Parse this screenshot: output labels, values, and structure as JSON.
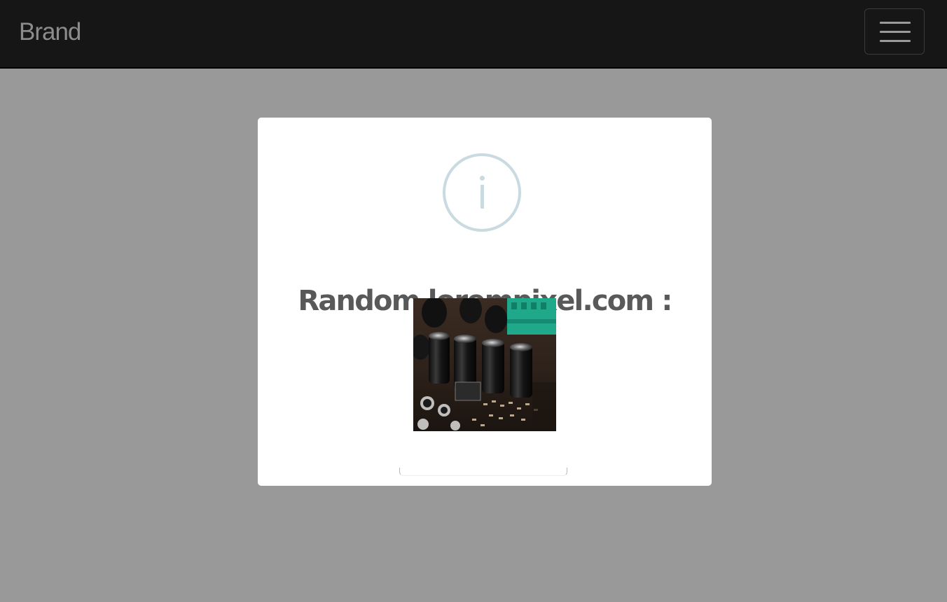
{
  "navbar": {
    "brand": "Brand",
    "menu_icon": "hamburger-menu-icon"
  },
  "modal": {
    "icon": "info-icon",
    "icon_color": "#c9dae1",
    "title": "Random lorempixel.com :",
    "image_alt": "circuit board with capacitors"
  },
  "colors": {
    "backdrop": "#999999",
    "navbar": "#161616",
    "brand_text": "#8c8c8c",
    "title_text": "#595959"
  }
}
